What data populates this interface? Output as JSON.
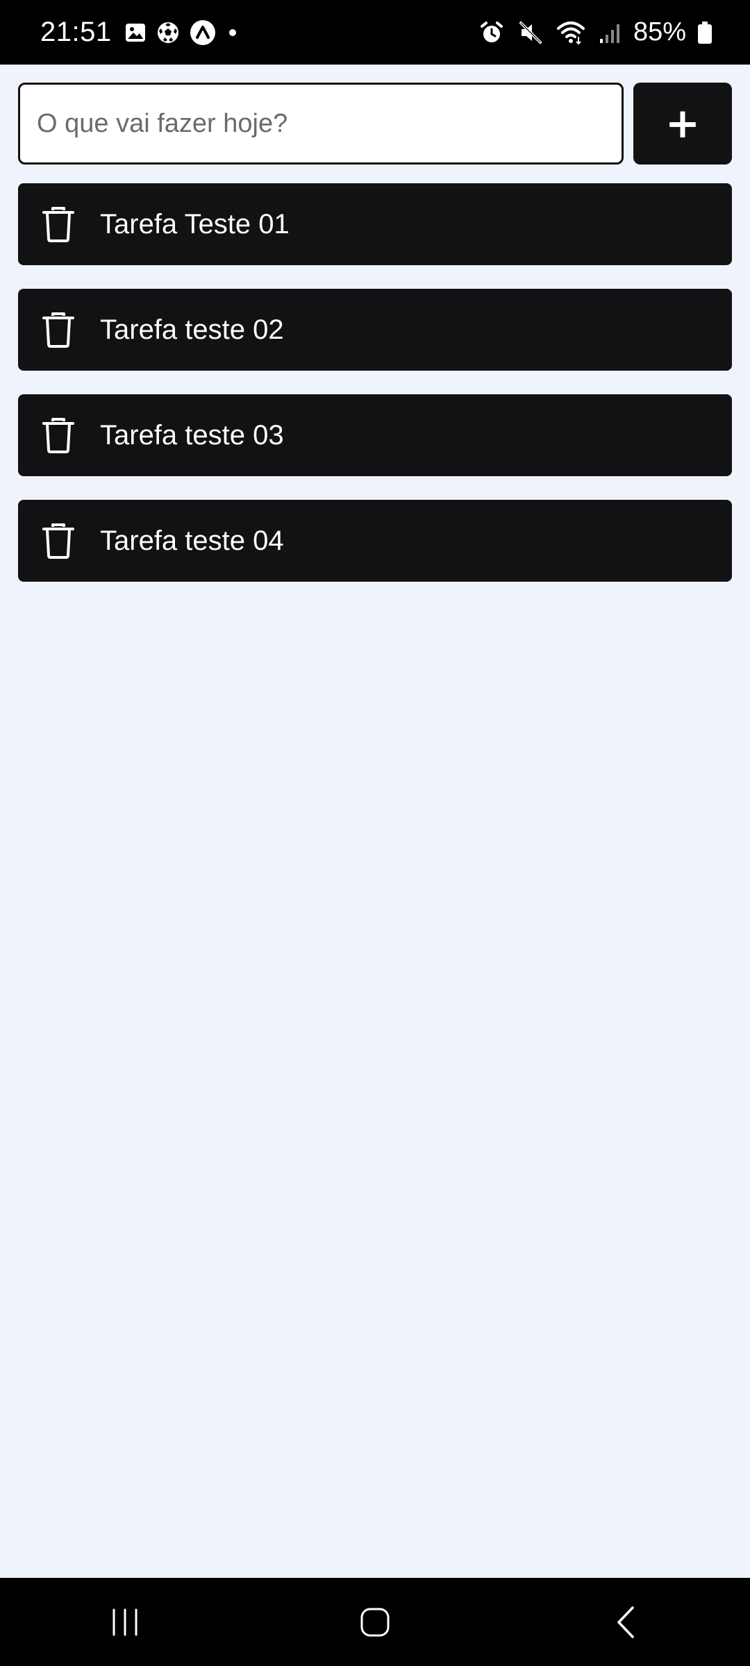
{
  "status_bar": {
    "time": "21:51",
    "left_icons": [
      "gallery-icon",
      "soccer-ball-icon",
      "expo-icon",
      "dot-icon"
    ],
    "right_icons": [
      "alarm-icon",
      "mute-icon",
      "wifi-icon",
      "signal-icon",
      "battery-icon"
    ],
    "battery": "85%"
  },
  "input": {
    "placeholder": "O que vai fazer hoje?",
    "value": ""
  },
  "add_button": {
    "label": "+"
  },
  "tasks": [
    {
      "title": "Tarefa Teste 01",
      "icon": "trash-icon"
    },
    {
      "title": "Tarefa teste 02",
      "icon": "trash-icon"
    },
    {
      "title": "Tarefa teste 03",
      "icon": "trash-icon"
    },
    {
      "title": "Tarefa teste 04",
      "icon": "trash-icon"
    }
  ],
  "nav_bar": {
    "buttons": [
      "recents-icon",
      "home-icon",
      "back-icon"
    ]
  },
  "colors": {
    "background": "#eff3fb",
    "task_bg": "#121214",
    "text_on_dark": "#ffffff"
  }
}
